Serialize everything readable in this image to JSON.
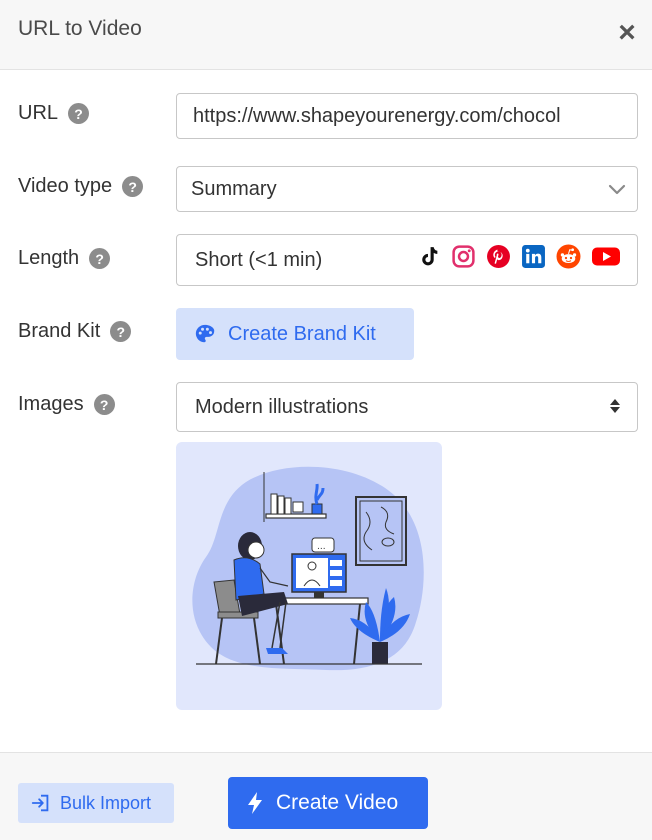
{
  "dialog": {
    "title": "URL to Video",
    "close_label": "×"
  },
  "form": {
    "url": {
      "label": "URL",
      "help": "?",
      "value": "https://www.shapeyourenergy.com/chocol"
    },
    "video_type": {
      "label": "Video type",
      "help": "?",
      "value": "Summary"
    },
    "length": {
      "label": "Length",
      "help": "?",
      "placeholder": "Short (<1 min)",
      "platforms": [
        "tiktok-icon",
        "instagram-icon",
        "pinterest-icon",
        "linkedin-icon",
        "reddit-icon",
        "youtube-icon"
      ]
    },
    "brand_kit": {
      "label": "Brand Kit",
      "help": "?",
      "button_label": "Create Brand Kit"
    },
    "images": {
      "label": "Images",
      "help": "?",
      "value": "Modern illustrations"
    }
  },
  "footer": {
    "bulk_import_label": "Bulk Import",
    "create_video_label": "Create Video"
  },
  "colors": {
    "accent": "#2f6bef",
    "accent_light": "#d5e1fb",
    "preview_bg": "#e1e7fc"
  }
}
